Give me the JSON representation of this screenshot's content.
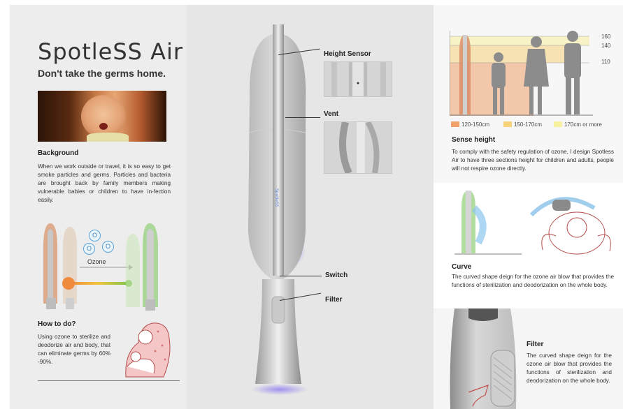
{
  "brand": {
    "logo_text": "SpotleSS Air",
    "tagline": "Don't take the germs home."
  },
  "background_section": {
    "title": "Background",
    "body": "When we work outside or travel, it is so easy to get smoke particles and germs. Particles and bacteria are brought back by family members making vulnerable babies or children to have in-fection easily."
  },
  "ozone_diagram": {
    "label": "Ozone",
    "bubbles": [
      "O",
      "O",
      "O"
    ]
  },
  "how_section": {
    "title": "How to do?",
    "body": "Using ozone to sterilize and deodorize air and body, that can eliminate germs by 60% -90%."
  },
  "callouts": {
    "height_sensor": "Height Sensor",
    "vent": "Vent",
    "switch": "Switch",
    "filter": "Filter"
  },
  "sense_height": {
    "heights": [
      "160",
      "140",
      "110"
    ],
    "legend": [
      {
        "label": "120-150cm",
        "color": "#f0a16a"
      },
      {
        "label": "150-170cm",
        "color": "#f6d27a"
      },
      {
        "label": "170cm or more",
        "color": "#f7f1a0"
      }
    ],
    "title": "Sense height",
    "body": "To comply with the safety regulation of ozone, I design Spotless Air to have three sections height for children and adults, people will not respire ozone directly."
  },
  "curve_section": {
    "title": "Curve",
    "body": "The curved shape deign for the ozone air blow that provides the functions of sterilization and deodorization on the whole body."
  },
  "filter_section": {
    "title": "Filter",
    "body": "The curved shape deign for the ozone air blow that provides the functions of sterilization and deodorization on the whole body."
  },
  "device_label": "SpotleSS"
}
